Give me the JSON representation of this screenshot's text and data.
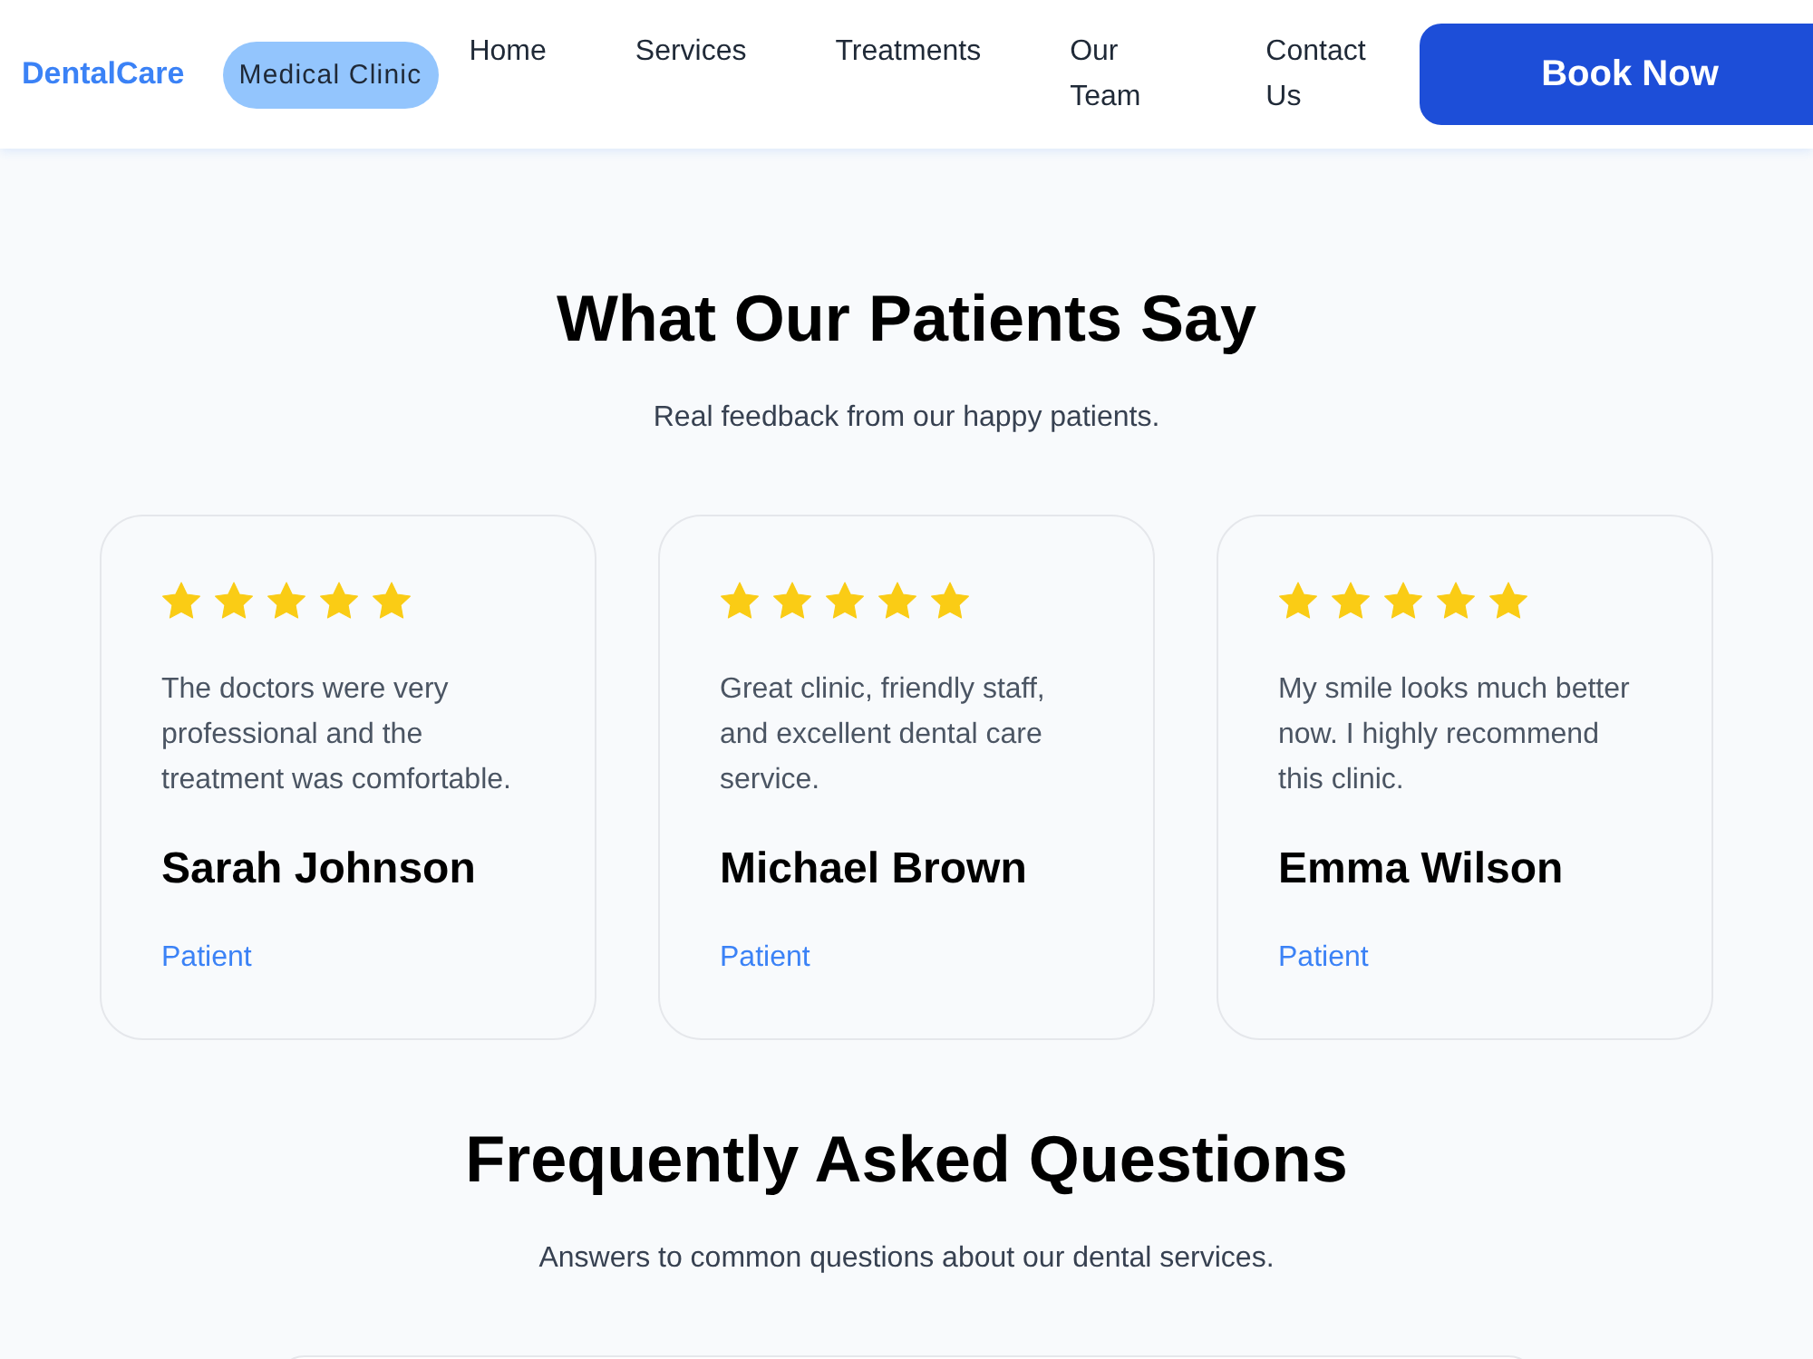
{
  "header": {
    "logo": "DentalCare",
    "badge": "Medical Clinic",
    "nav": [
      "Home",
      "Services",
      "Treatments",
      "Our Team",
      "Contact Us"
    ],
    "cta": "Book Now"
  },
  "testimonials": {
    "title": "What Our Patients Say",
    "subtitle": "Real feedback from our happy patients.",
    "reviews": [
      {
        "stars": 5,
        "quote": "The doctors were very professional and the treatment was comfortable.",
        "name": "Sarah Johnson",
        "role": "Patient"
      },
      {
        "stars": 5,
        "quote": "Great clinic, friendly staff, and excellent dental care service.",
        "name": "Michael Brown",
        "role": "Patient"
      },
      {
        "stars": 5,
        "quote": "My smile looks much better now. I highly recommend this clinic.",
        "name": "Emma Wilson",
        "role": "Patient"
      }
    ]
  },
  "faq": {
    "title": "Frequently Asked Questions",
    "subtitle": "Answers to common questions about our dental services."
  }
}
